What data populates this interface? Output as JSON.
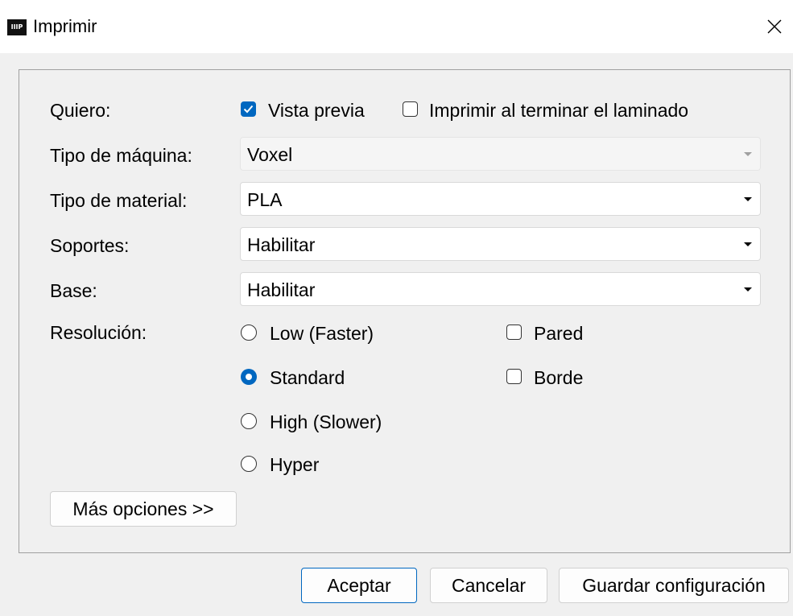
{
  "window": {
    "icon_text": "IIIP",
    "title": "Imprimir"
  },
  "form": {
    "quiero_label": "Quiero:",
    "vista_previa": {
      "label": "Vista previa",
      "checked": true
    },
    "imprimir_al_terminar": {
      "label": "Imprimir al terminar el laminado",
      "checked": false
    },
    "tipo_maquina": {
      "label": "Tipo de máquina:",
      "value": "Voxel",
      "enabled": false
    },
    "tipo_material": {
      "label": "Tipo de material:",
      "value": "PLA"
    },
    "soportes": {
      "label": "Soportes:",
      "value": "Habilitar"
    },
    "base": {
      "label": "Base:",
      "value": "Habilitar"
    },
    "resolucion": {
      "label": "Resolución:",
      "options": [
        {
          "label": "Low (Faster)",
          "selected": false
        },
        {
          "label": "Standard",
          "selected": true
        },
        {
          "label": "High (Slower)",
          "selected": false
        },
        {
          "label": "Hyper",
          "selected": false
        }
      ]
    },
    "pared": {
      "label": "Pared",
      "checked": false
    },
    "borde": {
      "label": "Borde",
      "checked": false
    },
    "mas_opciones": "Más opciones >>"
  },
  "buttons": {
    "aceptar": "Aceptar",
    "cancelar": "Cancelar",
    "guardar": "Guardar configuración"
  },
  "colors": {
    "accent": "#0067c0",
    "dialog_bg": "#f0f0f0",
    "titlebar_bg": "#ffffff"
  }
}
